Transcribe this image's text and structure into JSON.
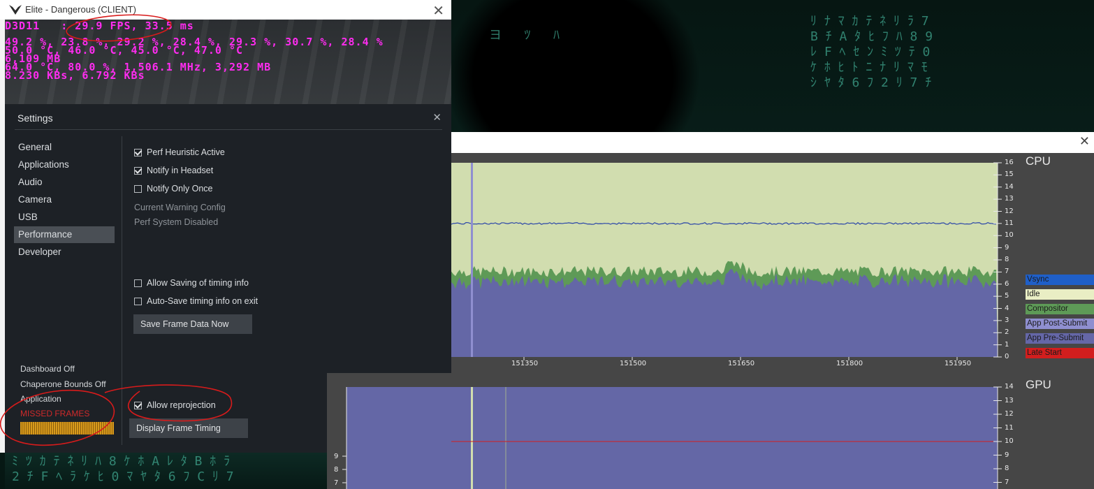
{
  "elite_window": {
    "title": "Elite - Dangerous (CLIENT)",
    "osd_lines": [
      "D3D11   : 29.9 FPS, 33.5 ms",
      "49.2 %, 23.8 %, 29.2 %, 28.4 %, 29.3 %, 30.7 %, 28.4 %",
      "50.0 °C, 46.0 °C, 45.0 °C, 47.0 °C",
      "6,109 MB",
      "64.0 °C, 80.0 %, 1,506.1 MHz, 3,292 MB",
      "8.230 KBs, 6.792 KBs"
    ]
  },
  "settings": {
    "title": "Settings",
    "nav": [
      "General",
      "Applications",
      "Audio",
      "Camera",
      "USB",
      "Performance",
      "Developer"
    ],
    "active_nav": "Performance",
    "checkboxes": {
      "perf_heuristic": "Perf Heuristic Active",
      "notify_headset": "Notify in Headset",
      "notify_once": "Notify Only Once",
      "allow_saving": "Allow Saving of timing info",
      "auto_save": "Auto-Save timing info on exit",
      "allow_reprojection": "Allow reprojection"
    },
    "checked": {
      "perf_heuristic": true,
      "notify_headset": true,
      "notify_once": false,
      "allow_saving": false,
      "auto_save": false,
      "allow_reprojection": true
    },
    "info_current_warning": "Current Warning Config",
    "info_perf_disabled": "Perf System Disabled",
    "save_frame_button": "Save Frame Data Now",
    "display_timing_button": "Display Frame Timing",
    "status": {
      "dashboard": "Dashboard Off",
      "chaperone": "Chaperone Bounds Off",
      "application": "Application",
      "missed_frames": "MISSED FRAMES"
    }
  },
  "timing": {
    "cpu_title": "CPU",
    "gpu_title": "GPU",
    "legend": [
      {
        "label": "Vsync",
        "color": "#1f5fc8",
        "text_color": "#1b1b1b"
      },
      {
        "label": "Idle",
        "color": "#e9eec4",
        "text_color": "#1b1b1b"
      },
      {
        "label": "Compositor",
        "color": "#5e9a57",
        "text_color": "#1b1b1b"
      },
      {
        "label": "App Post-Submit",
        "color": "#8f8fd0",
        "text_color": "#1b1b1b"
      },
      {
        "label": "App Pre-Submit",
        "color": "#6567a8",
        "text_color": "#1b1b1b"
      },
      {
        "label": "Late Start",
        "color": "#d21e1e",
        "text_color": "#1b1b1b"
      }
    ],
    "cpu_y_ticks": [
      "16",
      "15",
      "14",
      "13",
      "12",
      "11",
      "10",
      "9",
      "8",
      "7",
      "6",
      "5",
      "4",
      "3",
      "2",
      "1",
      "0"
    ],
    "cpu_x_ticks": [
      "151350",
      "151500",
      "151650",
      "151800",
      "151950"
    ],
    "gpu_y_ticks": [
      "14",
      "13",
      "12",
      "11",
      "10",
      "9",
      "8",
      "7"
    ],
    "gpu_left_ticks": [
      "9",
      "8",
      "7"
    ]
  }
}
